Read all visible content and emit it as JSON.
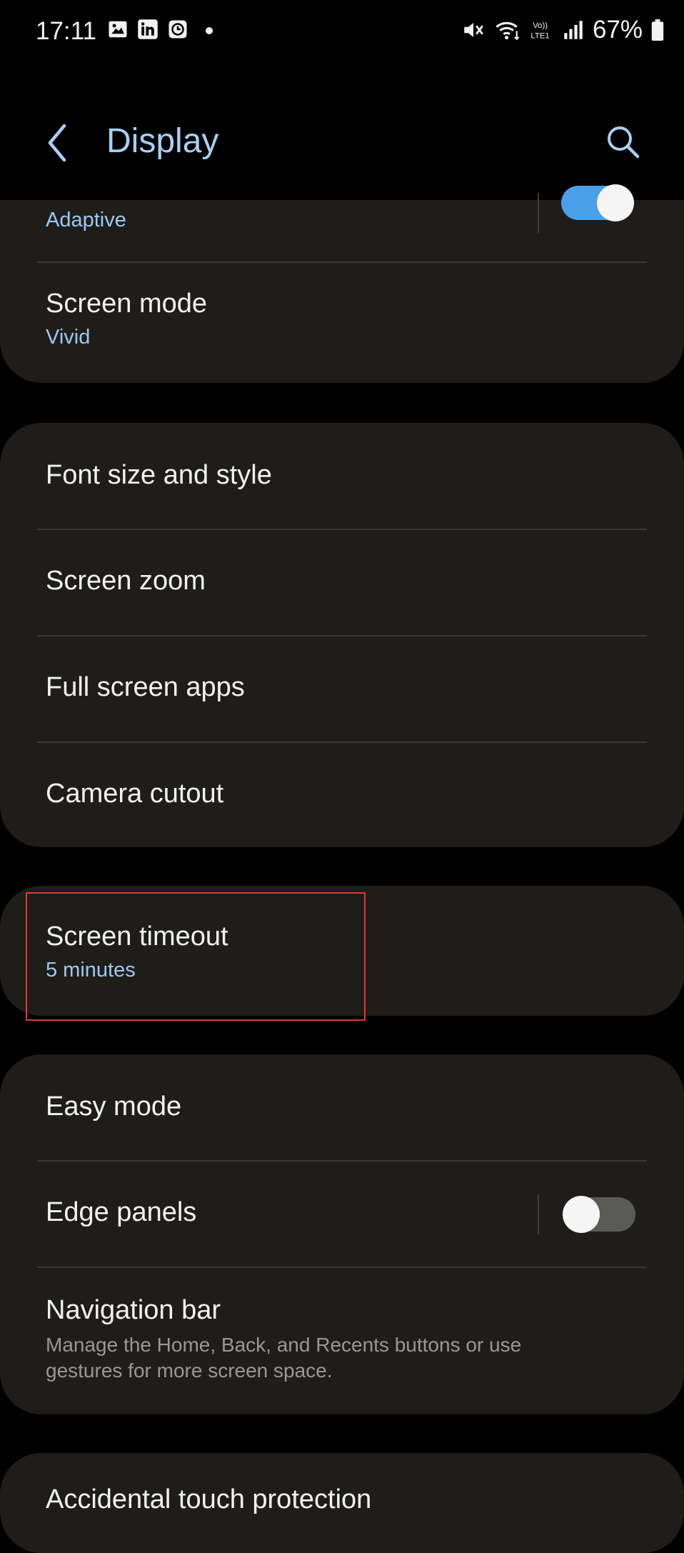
{
  "status_bar": {
    "time": "17:11",
    "battery": "67%",
    "left_icons": [
      "gallery-icon",
      "linkedin-icon",
      "clock-app-icon",
      "dot-icon"
    ],
    "right_icons": [
      "mute-icon",
      "wifi-icon",
      "volte-icon",
      "signal-icon",
      "battery-icon"
    ]
  },
  "header": {
    "title": "Display",
    "back_icon": "chevron-left-icon",
    "search_icon": "search-icon"
  },
  "sections": {
    "top": {
      "adaptive_sub": "Adaptive",
      "screen_mode_label": "Screen mode",
      "screen_mode_value": "Vivid"
    },
    "display_options": {
      "font_size": "Font size and style",
      "screen_zoom": "Screen zoom",
      "full_screen_apps": "Full screen apps",
      "camera_cutout": "Camera cutout"
    },
    "timeout": {
      "label": "Screen timeout",
      "value": "5 minutes"
    },
    "more": {
      "easy_mode": "Easy mode",
      "edge_panels": "Edge panels",
      "navigation_bar": "Navigation bar",
      "navigation_bar_desc": "Manage the Home, Back, and Recents buttons or use gestures for more screen space."
    },
    "bottom": {
      "accidental_touch": "Accidental touch protection"
    }
  },
  "toggles": {
    "adaptive_brightness": true,
    "edge_panels": false
  },
  "colors": {
    "accent": "#a9cff5",
    "card_bg": "#1f1d1a",
    "toggle_on": "#4a9fe8",
    "highlight": "#e53935"
  }
}
